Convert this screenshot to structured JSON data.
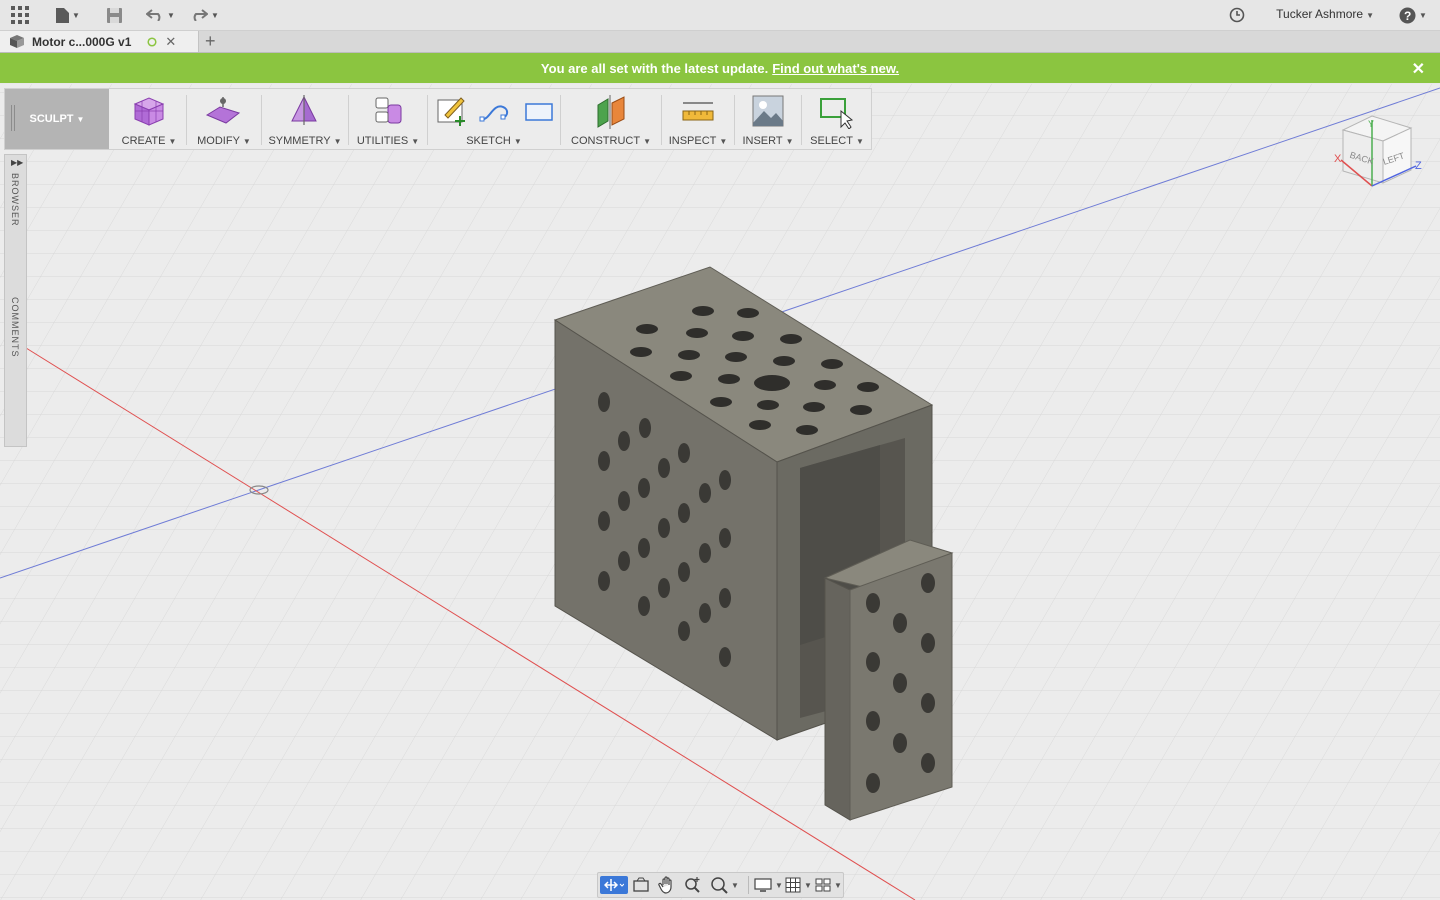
{
  "app": {
    "user_name": "Tucker Ashmore",
    "accent_color": "#8bc540"
  },
  "titlebar": {
    "icons": [
      "apps-grid-icon",
      "file-icon",
      "save-icon",
      "undo-icon",
      "redo-icon",
      "history-clock-icon",
      "help-icon"
    ]
  },
  "tab": {
    "title": "Motor c...000G v1",
    "new_tab_label": "+"
  },
  "banner": {
    "message": "You are all set with the latest update.",
    "link": "Find out what's new.",
    "close": "✕"
  },
  "toolbar": {
    "workspace": "SCULPT",
    "groups": [
      "CREATE",
      "MODIFY",
      "SYMMETRY",
      "UTILITIES",
      "SKETCH",
      "CONSTRUCT",
      "INSPECT",
      "INSERT",
      "SELECT"
    ]
  },
  "side_panel": {
    "browser": "BROWSER",
    "comments": "COMMENTS"
  },
  "viewcube": {
    "back": "BACK",
    "left": "LEFT",
    "x": "X",
    "y": "Y",
    "z": "Z"
  },
  "navbar": {
    "icons": [
      "orbit-icon",
      "look-at-icon",
      "pan-icon",
      "zoom-icon",
      "fit-icon",
      "display-settings-icon",
      "grid-settings-icon",
      "viewports-icon"
    ]
  }
}
